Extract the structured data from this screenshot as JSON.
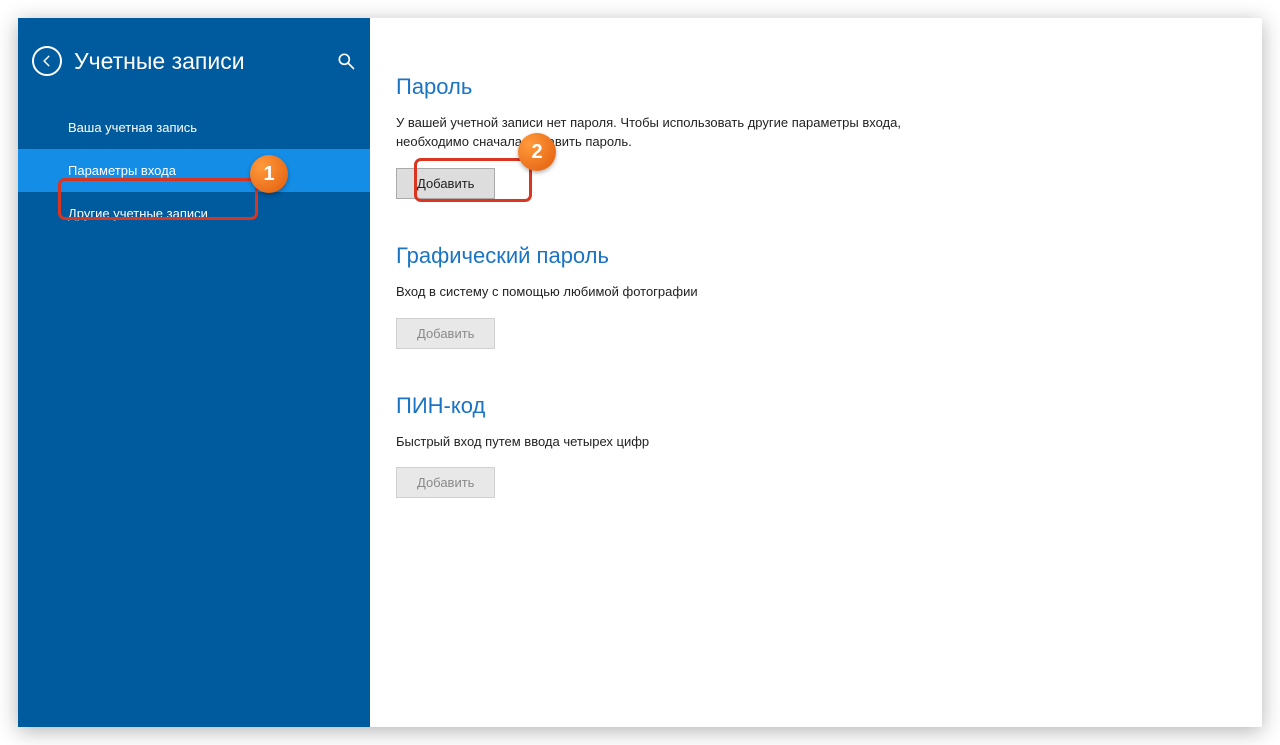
{
  "sidebar": {
    "title": "Учетные записи",
    "items": [
      {
        "label": "Ваша учетная запись"
      },
      {
        "label": "Параметры входа"
      },
      {
        "label": "Другие учетные записи"
      }
    ]
  },
  "annotations": {
    "badge1": "1",
    "badge2": "2"
  },
  "sections": {
    "password": {
      "title": "Пароль",
      "desc": "У вашей учетной записи нет пароля. Чтобы использовать другие параметры входа, необходимо сначала добавить пароль.",
      "button": "Добавить"
    },
    "picture": {
      "title": "Графический пароль",
      "desc": "Вход в систему с помощью любимой фотографии",
      "button": "Добавить"
    },
    "pin": {
      "title": "ПИН-код",
      "desc": "Быстрый вход путем ввода четырех цифр",
      "button": "Добавить"
    }
  }
}
